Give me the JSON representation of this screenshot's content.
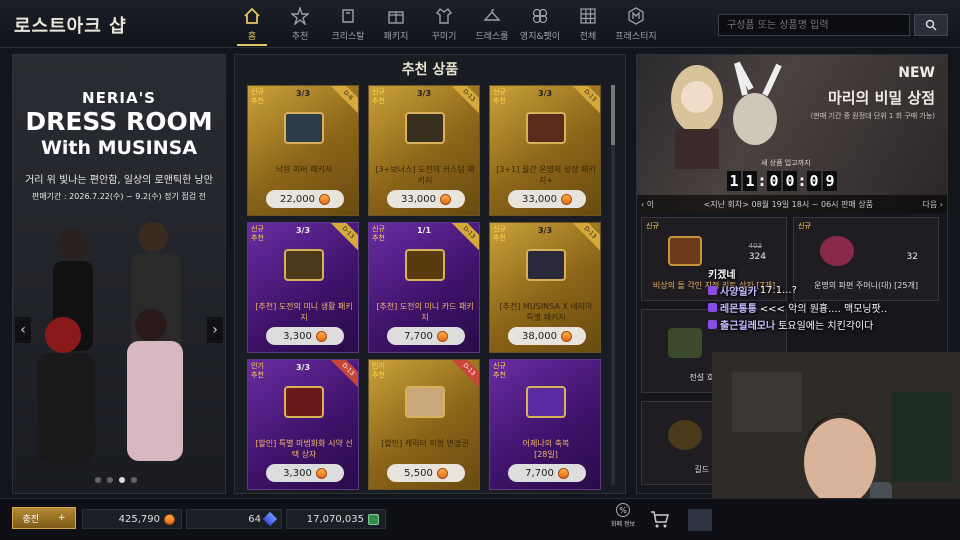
{
  "app": {
    "logo": "로스트아크 샵"
  },
  "nav": [
    {
      "label": "홈",
      "icon": "home-icon",
      "active": true
    },
    {
      "label": "추천",
      "icon": "star-icon"
    },
    {
      "label": "크리스탈",
      "icon": "crystal-icon"
    },
    {
      "label": "패키지",
      "icon": "package-icon"
    },
    {
      "label": "꾸미기",
      "icon": "outfit-icon"
    },
    {
      "label": "드레스룸",
      "icon": "hanger-icon"
    },
    {
      "label": "영지&펫이",
      "icon": "clover-icon"
    },
    {
      "label": "전체",
      "icon": "grid-icon"
    },
    {
      "label": "프레스티지",
      "icon": "prestige-icon"
    }
  ],
  "search": {
    "placeholder": "구성품 또는 상품명 입력"
  },
  "banner": {
    "line1": "NERIA'S",
    "line2": "DRESS ROOM",
    "line3": "With MUSINSA",
    "line4": "거리 위 빛나는 편안함, 일상의 로맨틱한 낭만",
    "line5": "판매기간 : 2026.7.22(수) ~ 9.2(수) 정기 점검 전"
  },
  "center": {
    "title": "추천 상품",
    "cards": [
      {
        "tag": "신규\n추천",
        "count": "3/3",
        "ribbon": "D-6",
        "name": "낙원 피버 패키지",
        "price": "22,000",
        "theme": "gold",
        "box": "#2d3a4a"
      },
      {
        "tag": "신규\n추천",
        "count": "3/3",
        "ribbon": "D-13",
        "name": "[3+보너스] 도전의 커스텀 패키지",
        "price": "33,000",
        "theme": "gold",
        "box": "#3a3020"
      },
      {
        "tag": "신규\n추천",
        "count": "3/3",
        "ribbon": "D-13",
        "name": "[3+1] 월간 운명의 성장 패키지+",
        "price": "33,000",
        "theme": "gold",
        "box": "#5a2a1a"
      },
      {
        "tag": "신규\n추천",
        "count": "3/3",
        "ribbon": "D-13",
        "name": "[추천] 도전의 미니 생활 패키지",
        "price": "3,300",
        "theme": "purple",
        "box": "#4a3a1a"
      },
      {
        "tag": "신규\n추천",
        "count": "1/1",
        "ribbon": "D-13",
        "name": "[추천] 도전의 미니 카드 패키지",
        "price": "7,700",
        "theme": "purple",
        "box": "#5a3a10"
      },
      {
        "tag": "신규\n추천",
        "count": "3/3",
        "ribbon": "D-13",
        "name": "[추천] MUSINSA X 네리아 특별 패키지",
        "price": "38,000",
        "theme": "gold",
        "box": "#2a2a3a"
      },
      {
        "tag": "인기\n추천",
        "count": "3/3",
        "ribbon": "D-13",
        "name": "[할인] 특별 마법화화 시약 선택 상자",
        "price": "3,300",
        "theme": "purple",
        "box": "#6a1a1a"
      },
      {
        "tag": "인기\n추천",
        "count": "",
        "ribbon": "D-13",
        "name": "[할인] 캐릭터 외형 변경권",
        "price": "5,500",
        "theme": "gold",
        "box": "#c9a77a"
      },
      {
        "tag": "신규\n추천",
        "count": "",
        "ribbon": "",
        "name": "어제나의 축복\n[28일]",
        "price": "7,700",
        "theme": "purple",
        "box": "#5a2aa0"
      }
    ]
  },
  "feature": {
    "new": "NEW",
    "title": "마리의 비밀 상점",
    "subtitle": "(판매 기간 중 원정대 단위 1 회 구매 가능)",
    "until": "새 상품 입고까지",
    "timer": [
      "1",
      "1",
      "0",
      "0",
      "0",
      "9"
    ],
    "prev": "이",
    "history": "<지난 회차> 08월 19일 18시 ~ 06시 판매 상품",
    "next": "다음"
  },
  "mini": [
    {
      "tag": "신규",
      "old": "403",
      "num": "324",
      "label": "비상의 돌 각인 지정 키트 상자 [7개]",
      "color": "#6a3a1a"
    },
    {
      "tag": "신규",
      "old": "",
      "num": "32",
      "label": "운명의 파편 주머니(대) [25개]",
      "color": "#8a2a4a",
      "white": true
    },
    {
      "tag": "",
      "old": "",
      "num": "",
      "label": "전설 호감도 선",
      "color": "#3a4a2a",
      "white": true
    },
    {
      "tag": "",
      "old": "",
      "num": "",
      "label": "길드 명예의",
      "color": "#4a3a1a",
      "white": true
    }
  ],
  "chat": [
    {
      "user": "키겠네",
      "text": ""
    },
    {
      "user": "사양일카",
      "text": "17.1...?"
    },
    {
      "user": "레몬통통",
      "text": "<<< 악의 원흉.... 맥모닝팟.."
    },
    {
      "user": "출근길레모나",
      "text": "토요일에는 치킨각이다"
    }
  ],
  "bottom": {
    "charge": "충전",
    "plus": "+",
    "gold": "425,790",
    "crystal": "64",
    "silver": "17,070,035",
    "rate_label": "화폐 정보"
  }
}
